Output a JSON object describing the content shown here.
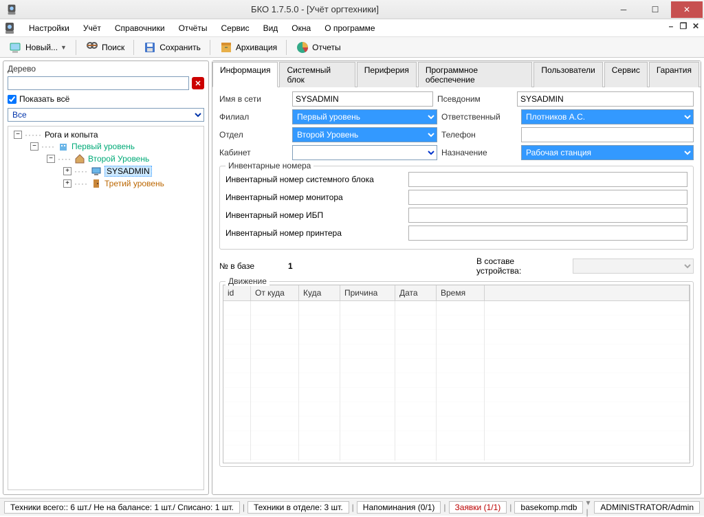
{
  "window": {
    "title": "БКО 1.7.5.0 - [Учёт оргтехники]"
  },
  "menu": [
    "Настройки",
    "Учёт",
    "Справочники",
    "Отчёты",
    "Сервис",
    "Вид",
    "Окна",
    "О программе"
  ],
  "toolbar": {
    "new": "Новый...",
    "search": "Поиск",
    "save": "Сохранить",
    "archive": "Архивация",
    "reports": "Отчеты"
  },
  "left": {
    "title": "Дерево",
    "show_all": "Показать всё",
    "filter": "Все",
    "tree": {
      "root": "Рога и копыта",
      "l1": "Первый уровень",
      "l2": "Второй Уровень",
      "sys": "SYSADMIN",
      "l3": "Третий уровень"
    }
  },
  "tabs": [
    "Информация",
    "Системный блок",
    "Периферия",
    "Программное обеспечение",
    "Пользователи",
    "Сервис",
    "Гарантия"
  ],
  "form": {
    "net_name_lbl": "Имя в сети",
    "net_name_val": "SYSADMIN",
    "alias_lbl": "Псевдоним",
    "alias_val": "SYSADMIN",
    "branch_lbl": "Филиал",
    "branch_val": "Первый уровень",
    "resp_lbl": "Ответственный",
    "resp_val": "Плотников А.С.",
    "dept_lbl": "Отдел",
    "dept_val": "Второй Уровень",
    "phone_lbl": "Телефон",
    "room_lbl": "Кабинет",
    "purpose_lbl": "Назначение",
    "purpose_val": "Рабочая станция",
    "inv_group": "Инвентарные номера",
    "inv_sys": "Инвентарный номер системного блока",
    "inv_mon": "Инвентарный номер монитора",
    "inv_ups": "Инвентарный номер ИБП",
    "inv_prn": "Инвентарный номер принтера",
    "base_no_lbl": "№ в базе",
    "base_no_val": "1",
    "comp_lbl": "В составе устройства:",
    "move_group": "Движение",
    "cols": {
      "id": "id",
      "from": "От куда",
      "to": "Куда",
      "reason": "Причина",
      "date": "Дата",
      "time": "Время"
    }
  },
  "status": {
    "total": "Техники всего:: 6 шт./ Не на балансе: 1 шт./ Списано: 1 шт.",
    "dept": "Техники в отделе:    3 шт.",
    "remind": "Напоминания (0/1)",
    "req": "Заявки (1/1)",
    "db": "basekomp.mdb",
    "user": "ADMINISTRATOR/Admin"
  }
}
